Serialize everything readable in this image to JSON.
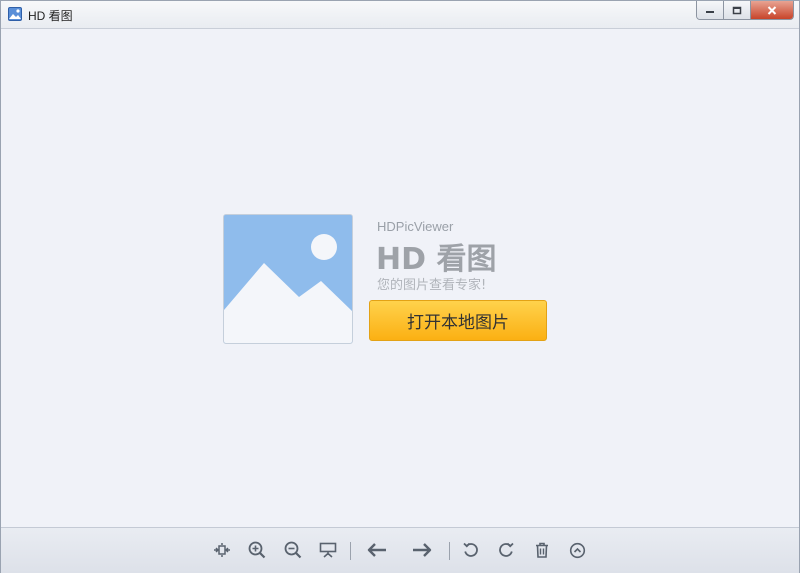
{
  "window": {
    "title": "HD 看图",
    "icon": "picture-icon",
    "controls": [
      "minimize-icon",
      "restore-icon",
      "close-icon"
    ]
  },
  "welcome": {
    "brand_en": "HDPicViewer",
    "brand_cn": "HD 看图",
    "slogan": "您的图片查看专家!",
    "open_button_label": "打开本地图片",
    "placeholder_icon": "image-placeholder-icon"
  },
  "toolbar": {
    "items": [
      "fit-to-window-icon",
      "zoom-in-icon",
      "zoom-out-icon",
      "slideshow-icon",
      "previous-arrow-icon",
      "next-arrow-icon",
      "rotate-left-icon",
      "rotate-right-icon",
      "delete-icon",
      "more-up-icon"
    ]
  },
  "colors": {
    "accent_button": "#fbb013",
    "placeholder_sky": "#8fbcec",
    "toolbar_icon": "#59626e",
    "close_button": "#c8442a"
  }
}
